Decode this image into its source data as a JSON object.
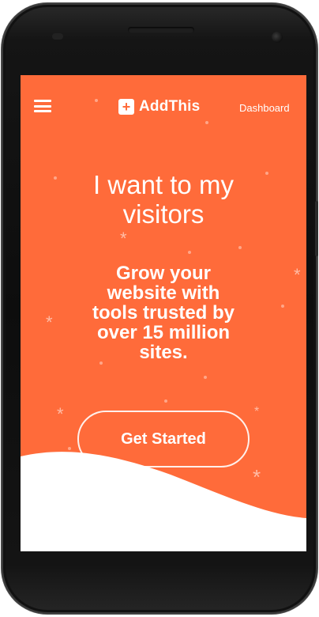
{
  "header": {
    "menu_icon": "hamburger-menu-icon",
    "brand_icon": "plus-square-icon",
    "brand_icon_glyph": "+",
    "brand_name": "AddThis",
    "dashboard_link": "Dashboard"
  },
  "hero": {
    "headline_line1": "I want to  my",
    "headline_line2": "visitors",
    "subheadline_line1": "Grow your",
    "subheadline_line2": "website with",
    "subheadline_line3": "tools trusted by",
    "subheadline_line4": "over 15 million",
    "subheadline_line5": "sites.",
    "cta_label": "Get Started"
  },
  "colors": {
    "accent": "#ff6b3a",
    "text": "#ffffff",
    "device_frame": "#111111",
    "wave_fill": "#ffffff"
  }
}
